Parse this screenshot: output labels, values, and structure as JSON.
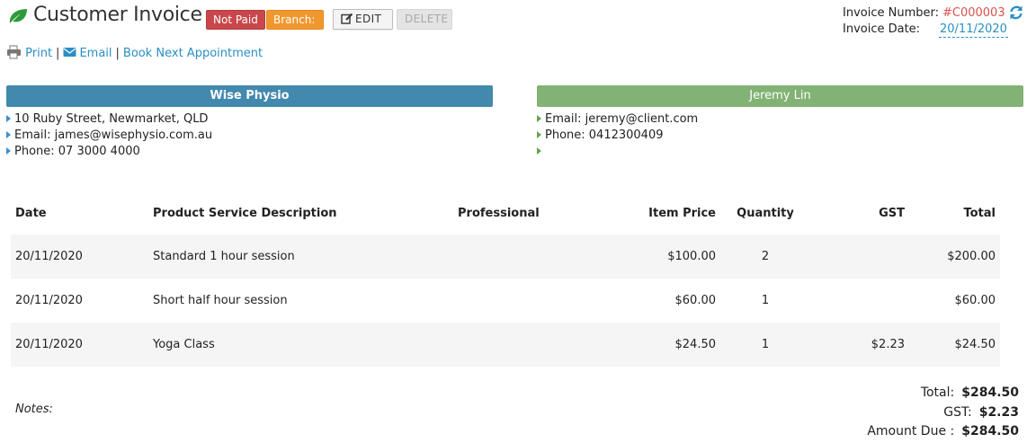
{
  "header": {
    "title": "Customer Invoice",
    "status_badge": "Not Paid",
    "branch_badge": "Branch:",
    "edit_label": "EDIT",
    "delete_label": "DELETE",
    "invoice_number_label": "Invoice Number:",
    "invoice_number": "#C000003",
    "invoice_date_label": "Invoice Date:",
    "invoice_date": "20/11/2020"
  },
  "actions": {
    "print": "Print",
    "email": "Email",
    "book": "Book Next Appointment",
    "separator": "|"
  },
  "business": {
    "name": "Wise Physio",
    "lines": [
      "10 Ruby Street, Newmarket, QLD",
      "Email: james@wisephysio.com.au",
      "Phone: 07 3000 4000"
    ]
  },
  "client": {
    "name": "Jeremy Lin",
    "lines": [
      "Email: jeremy@client.com",
      "Phone: 0412300409",
      ""
    ]
  },
  "table": {
    "columns": [
      "Date",
      "Product Service Description",
      "Professional",
      "Item Price",
      "Quantity",
      "GST",
      "Total"
    ],
    "rows": [
      [
        "20/11/2020",
        "Standard 1 hour session",
        "",
        "$100.00",
        "2",
        "",
        "$200.00"
      ],
      [
        "20/11/2020",
        "Short half hour session",
        "",
        "$60.00",
        "1",
        "",
        "$60.00"
      ],
      [
        "20/11/2020",
        "Yoga Class",
        "",
        "$24.50",
        "1",
        "$2.23",
        "$24.50"
      ]
    ]
  },
  "notes_label": "Notes:",
  "totals": {
    "total_label": "Total:",
    "total": "$284.50",
    "gst_label": "GST:",
    "gst": "$2.23",
    "due_label": "Amount Due :",
    "due": "$284.50"
  },
  "colors": {
    "business_bar": "#4289ad",
    "client_bar": "#82b274",
    "not_paid": "#c9474a",
    "branch": "#f0982e",
    "link": "#2a8fc2",
    "invoice_number": "#d9534f"
  },
  "icons": {
    "logo": "leaf-icon",
    "edit": "edit-icon",
    "refresh": "refresh-icon",
    "print": "printer-icon",
    "email": "envelope-icon"
  }
}
